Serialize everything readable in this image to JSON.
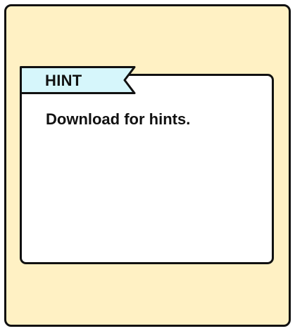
{
  "hint_panel": {
    "tab_label": "HINT",
    "message": "Download for hints.",
    "colors": {
      "panel_background": "#fff1c4",
      "card_background": "#ffffff",
      "tab_background": "#d6f6fb",
      "outline": "#111111"
    }
  }
}
